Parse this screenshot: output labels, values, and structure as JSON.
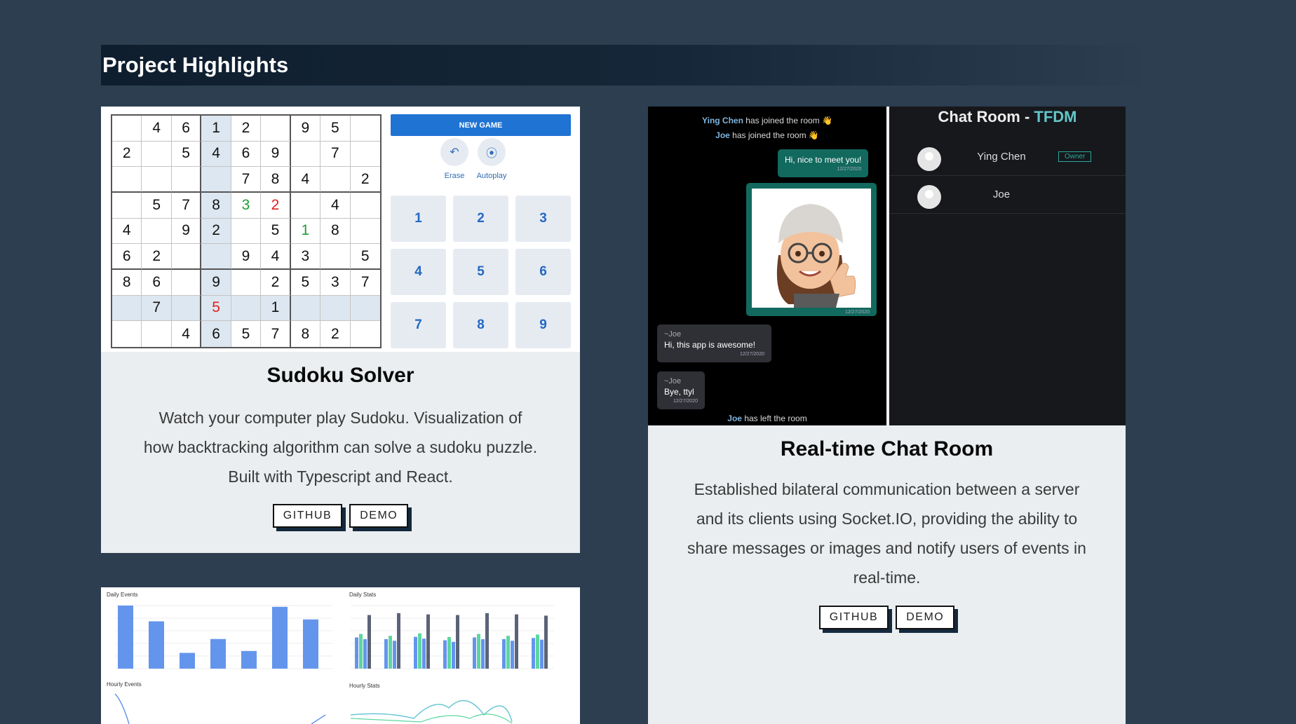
{
  "section": {
    "title": "Project Highlights"
  },
  "sudoku": {
    "grid": [
      [
        "",
        "4",
        "6",
        "1",
        "2",
        "",
        "9",
        "5",
        ""
      ],
      [
        "2",
        "",
        "5",
        "4",
        "6",
        "9",
        "",
        "7",
        ""
      ],
      [
        "",
        "",
        "",
        "",
        "7",
        "8",
        "4",
        "",
        "2"
      ],
      [
        "",
        "5",
        "7",
        "8",
        "3",
        "2",
        "",
        "4",
        ""
      ],
      [
        "4",
        "",
        "9",
        "2",
        "",
        "5",
        "1",
        "8",
        ""
      ],
      [
        "6",
        "2",
        "",
        "",
        "9",
        "4",
        "3",
        "",
        "5"
      ],
      [
        "8",
        "6",
        "",
        "9",
        "",
        "2",
        "5",
        "3",
        "7"
      ],
      [
        "",
        "7",
        "",
        "5",
        "",
        "1",
        "",
        "",
        ""
      ],
      [
        "",
        "",
        "4",
        "6",
        "5",
        "7",
        "8",
        "2",
        ""
      ]
    ],
    "new_game_label": "NEW GAME",
    "erase_label": "Erase",
    "autoplay_label": "Autoplay",
    "numpad": [
      "1",
      "2",
      "3",
      "4",
      "5",
      "6",
      "7",
      "8",
      "9"
    ],
    "title": "Sudoku Solver",
    "description": "Watch your computer play Sudoku. Visualization of how backtracking algorithm can solve a sudoku puzzle. Built with Typescript and React.",
    "github_label": "GITHUB",
    "demo_label": "DEMO"
  },
  "chat": {
    "join1_name": "Ying Chen",
    "join1_text": " has joined the room 👋",
    "join2_name": "Joe",
    "join2_text": " has joined the room 👋",
    "msg1": "Hi, nice to meet you!",
    "msg1_time": "12/27/2020",
    "img_time": "12/27/2020",
    "msg2_author": "~Joe",
    "msg2": "Hi, this app is awesome!",
    "msg2_time": "12/27/2020",
    "msg3_author": "~Joe",
    "msg3": "Bye, ttyl",
    "msg3_time": "12/27/2020",
    "left_name": "Joe",
    "left_text": " has left the room",
    "room_title_prefix": "Chat Room - ",
    "room_title_accent": "TFDM",
    "members": [
      {
        "name": "Ying Chen",
        "badge": "Owner"
      },
      {
        "name": "Joe",
        "badge": ""
      }
    ],
    "title": "Real-time Chat Room",
    "description": "Established bilateral communication between a server and its clients using Socket.IO, providing the ability to share messages or images and notify users of events in real-time.",
    "github_label": "GITHUB",
    "demo_label": "DEMO"
  },
  "dashboard": {
    "daily_events_title": "Daily Events",
    "daily_stats_title": "Daily Stats",
    "hourly_events_title": "Hourly Events",
    "hourly_stats_title": "Hourly Stats",
    "daily_events_values": [
      100,
      75,
      25,
      47,
      28,
      98,
      78
    ],
    "daily_stats_values": [
      [
        55,
        85
      ],
      [
        52,
        88
      ],
      [
        56,
        86
      ],
      [
        50,
        85
      ],
      [
        55,
        88
      ],
      [
        52,
        86
      ],
      [
        54,
        84
      ]
    ],
    "colors": {
      "blue": "#6495ed",
      "green": "#5cd6a0",
      "dark": "#5b6378"
    }
  }
}
